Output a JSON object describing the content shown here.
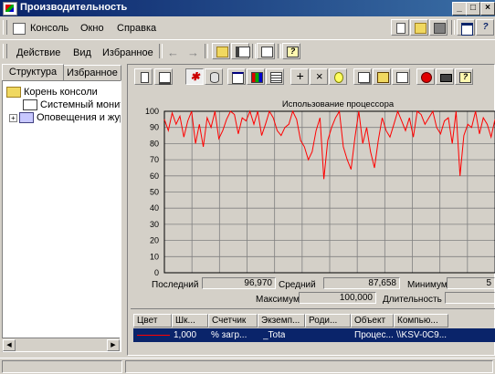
{
  "window": {
    "title": "Производительность"
  },
  "menubar": [
    {
      "label": "Консоль"
    },
    {
      "label": "Окно"
    },
    {
      "label": "Справка"
    }
  ],
  "actionbar": [
    {
      "label": "Действие"
    },
    {
      "label": "Вид"
    },
    {
      "label": "Избранное"
    }
  ],
  "tabs": [
    {
      "label": "Структура"
    },
    {
      "label": "Избранное"
    }
  ],
  "tree": [
    {
      "label": "Корень консоли"
    },
    {
      "label": "Системный монитор"
    },
    {
      "label": "Оповещения и журналы"
    }
  ],
  "chart_data": {
    "type": "line",
    "title": "Использование процессора",
    "ylim": [
      0,
      100
    ],
    "yticks": [
      0,
      10,
      20,
      30,
      40,
      50,
      60,
      70,
      80,
      90,
      100
    ],
    "grid": true,
    "series": [
      {
        "color": "#ff0000",
        "values": [
          95,
          88,
          99,
          92,
          97,
          84,
          94,
          100,
          80,
          92,
          78,
          96,
          90,
          100,
          83,
          88,
          95,
          100,
          98,
          86,
          96,
          94,
          100,
          92,
          100,
          85,
          92,
          100,
          96,
          88,
          85,
          90,
          92,
          100,
          95,
          82,
          78,
          70,
          75,
          88,
          96,
          58,
          82,
          90,
          96,
          100,
          78,
          70,
          64,
          84,
          100,
          80,
          90,
          75,
          65,
          82,
          96,
          88,
          84,
          92,
          100,
          94,
          88,
          96,
          84,
          100,
          98,
          92,
          96,
          100,
          90,
          86,
          94,
          96,
          80,
          100,
          60,
          85,
          92,
          90,
          100,
          86,
          96,
          92,
          84,
          95
        ]
      }
    ]
  },
  "stats": {
    "last_label": "Последний",
    "last_value": "96,970",
    "avg_label": "Средний",
    "avg_value": "87,658",
    "min_label": "Минимум",
    "min_value": "5",
    "max_label": "Максимум",
    "max_value": "100,000",
    "dur_label": "Длительность"
  },
  "columns": [
    {
      "label": "Цвет"
    },
    {
      "label": "Шк..."
    },
    {
      "label": "Счетчик"
    },
    {
      "label": "Экземп..."
    },
    {
      "label": "Роди..."
    },
    {
      "label": "Объект"
    },
    {
      "label": "Компью..."
    }
  ],
  "counter_row": [
    "1,000",
    "% загр...",
    "_Tota",
    "Процес...",
    "\\\\KSV-0C9..."
  ]
}
